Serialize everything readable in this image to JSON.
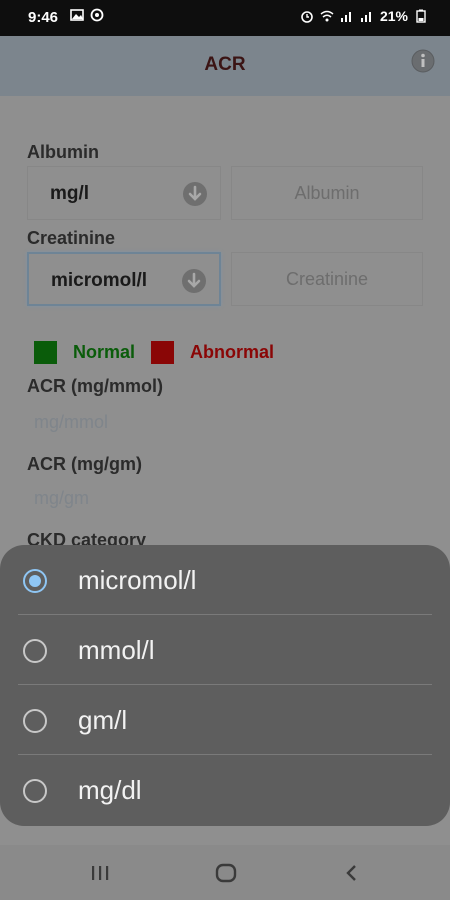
{
  "status": {
    "time": "9:46",
    "battery": "21%"
  },
  "app_bar": {
    "title": "ACR"
  },
  "form": {
    "albumin_label": "Albumin",
    "albumin_unit": "mg/l",
    "albumin_placeholder": "Albumin",
    "creatinine_label": "Creatinine",
    "creatinine_unit": "micromol/l",
    "creatinine_placeholder": "Creatinine"
  },
  "legend": {
    "normal_label": "Normal",
    "normal_color": "#0a5c0a",
    "abnormal_label": "Abnormal",
    "abnormal_color": "#8a0606"
  },
  "results": {
    "acr_mmol_label": "ACR (mg/mmol)",
    "acr_mmol_placeholder": "mg/mmol",
    "acr_gm_label": "ACR (mg/gm)",
    "acr_gm_placeholder": "mg/gm",
    "ckd_label": "CKD category"
  },
  "dialog": {
    "options": [
      {
        "label": "micromol/l",
        "selected": true
      },
      {
        "label": "mmol/l",
        "selected": false
      },
      {
        "label": "gm/l",
        "selected": false
      },
      {
        "label": "mg/dl",
        "selected": false
      }
    ]
  },
  "icons": {
    "info": "info-icon",
    "dropdown": "arrow-down-circle-icon",
    "nav_recents": "recents-icon",
    "nav_home": "home-icon",
    "nav_back": "back-icon"
  }
}
